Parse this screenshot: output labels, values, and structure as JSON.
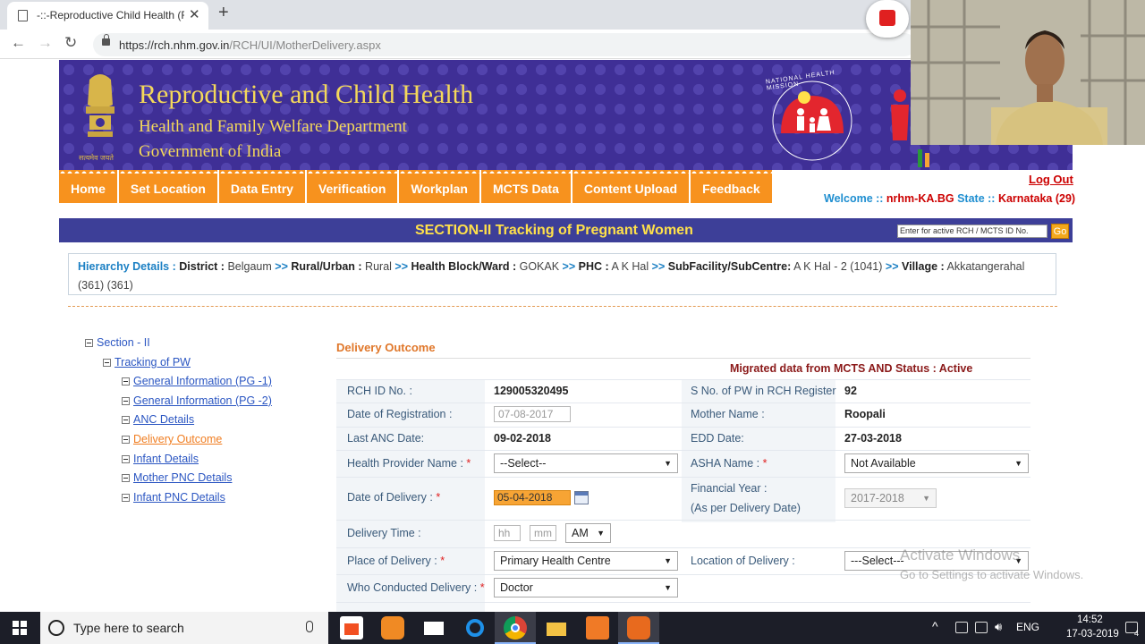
{
  "browser": {
    "tab_title": "-::-Reproductive Child Health (Ro",
    "url_host": "https://rch.nhm.gov.in",
    "url_path": "/RCH/UI/MotherDelivery.aspx"
  },
  "banner": {
    "title": "Reproductive and Child Health",
    "line2": "Health and Family Welfare Department",
    "line3": "Government of India",
    "emblem_text": "सत्यमेव जयते",
    "nhm_text": "NATIONAL HEALTH MISSION"
  },
  "menu": [
    "Home",
    "Set Location",
    "Data Entry",
    "Verification",
    "Workplan",
    "MCTS Data",
    "Content Upload",
    "Feedback"
  ],
  "user": {
    "logout": "Log Out",
    "welcome_prefix": "Welcome :: ",
    "username": "nrhm-KA.BG",
    "state_label": " State :: ",
    "state": "Karnataka (29)"
  },
  "section": {
    "title": "SECTION-II Tracking of Pregnant Women",
    "search_placeholder": "Enter for active RCH / MCTS ID No.",
    "go": "Go"
  },
  "hierarchy": {
    "label": "Hierarchy Details :",
    "district_label": "District :",
    "district": "Belgaum",
    "rural_label": "Rural/Urban :",
    "rural": "Rural",
    "block_label": "Health Block/Ward :",
    "block": "GOKAK",
    "phc_label": "PHC :",
    "phc": "A K Hal",
    "subfac_label": "SubFacility/SubCentre:",
    "subfac": "A K Hal - 2 (1041)",
    "village_label": "Village :",
    "village": "Akkatangerahal (361) (361)",
    "sep": ">>"
  },
  "tree": {
    "root": "Section - II",
    "child": "Tracking of PW",
    "items": [
      "General Information (PG -1)",
      "General Information (PG -2)",
      "ANC Details",
      "Delivery Outcome",
      "Infant Details",
      "Mother PNC Details",
      "Infant PNC Details"
    ]
  },
  "form": {
    "title": "Delivery Outcome",
    "migrated": "Migrated data from MCTS AND   Status : Active",
    "rch_id_label": "RCH ID No. :",
    "rch_id": "129005320495",
    "sno_label": "S No. of PW in RCH Register",
    "sno": "92",
    "reg_date_label": "Date of Registration :",
    "reg_date": "07-08-2017",
    "mother_label": "Mother Name :",
    "mother": "Roopali",
    "anc_label": "Last ANC Date:",
    "anc": "09-02-2018",
    "edd_label": "EDD Date:",
    "edd": "27-03-2018",
    "hp_label": "Health Provider Name :",
    "hp": "--Select--",
    "asha_label": "ASHA Name :",
    "asha": "Not Available",
    "dod_label": "Date of Delivery :",
    "dod": "05-04-2018",
    "fy_label1": "Financial Year :",
    "fy_label2": "(As per Delivery Date)",
    "fy": "2017-2018",
    "time_label": "Delivery Time :",
    "hh": "hh",
    "mm": "mm",
    "ampm": "AM",
    "place_label": "Place of Delivery :",
    "place": "Primary Health Centre",
    "loc_label": "Location of Delivery :",
    "loc": "---Select---",
    "who_label": "Who Conducted Delivery :",
    "who": "Doctor",
    "star": "*"
  },
  "watermark": {
    "line1": "Activate Windows",
    "line2": "Go to Settings to activate Windows."
  },
  "taskbar": {
    "search": "Type here to search",
    "lang": "ENG",
    "time": "14:52",
    "date": "17-03-2019",
    "notif": "4"
  }
}
